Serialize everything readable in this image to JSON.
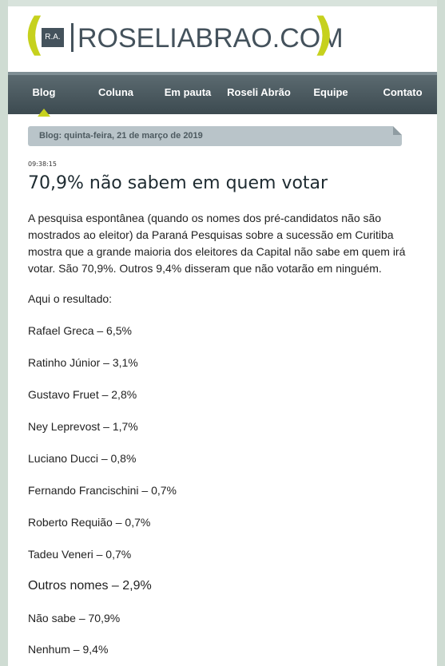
{
  "header": {
    "logo_initials": "R.A.",
    "site_name": "ROSELIABRAO.COM",
    "paren_left": "(",
    "paren_right": ")"
  },
  "nav": {
    "items": [
      {
        "label": "Blog"
      },
      {
        "label": "Coluna"
      },
      {
        "label": "Em pauta"
      },
      {
        "label": "Roseli Abrão"
      },
      {
        "label": "Equipe"
      },
      {
        "label": "Contato"
      }
    ],
    "active": "Blog"
  },
  "post": {
    "date_heading": "Blog: quinta-feira, 21 de março de 2019",
    "timestamp": "09:38:15",
    "title": "70,9% não sabem em quem votar",
    "intro": "A pesquisa espontânea (quando os nomes dos pré-candidatos não são mostrados ao eleitor) da Paraná Pesquisas sobre a sucessão em Curitiba mostra que a grande maioria dos eleitores da Capital não sabe em quem irá votar. São 70,9%. Outros 9,4% disseram que não votarão em ninguém.",
    "results_intro": "Aqui o resultado:",
    "results": [
      "Rafael Greca – 6,5%",
      "Ratinho Júnior – 3,1%",
      "Gustavo Fruet – 2,8%",
      "Ney Leprevost – 1,7%",
      "Luciano Ducci – 0,8%",
      "Fernando Francischini – 0,7%",
      "Roberto Requião – 0,7%",
      "Tadeu Veneri – 0,7%",
      "Outros nomes – 2,9%",
      "Não sabe – 70,9%",
      "Nenhum – 9,4%"
    ]
  },
  "colors": {
    "accent": "#c6d11d",
    "nav_bg": "#44525c",
    "date_bar": "#b9c4c9"
  }
}
